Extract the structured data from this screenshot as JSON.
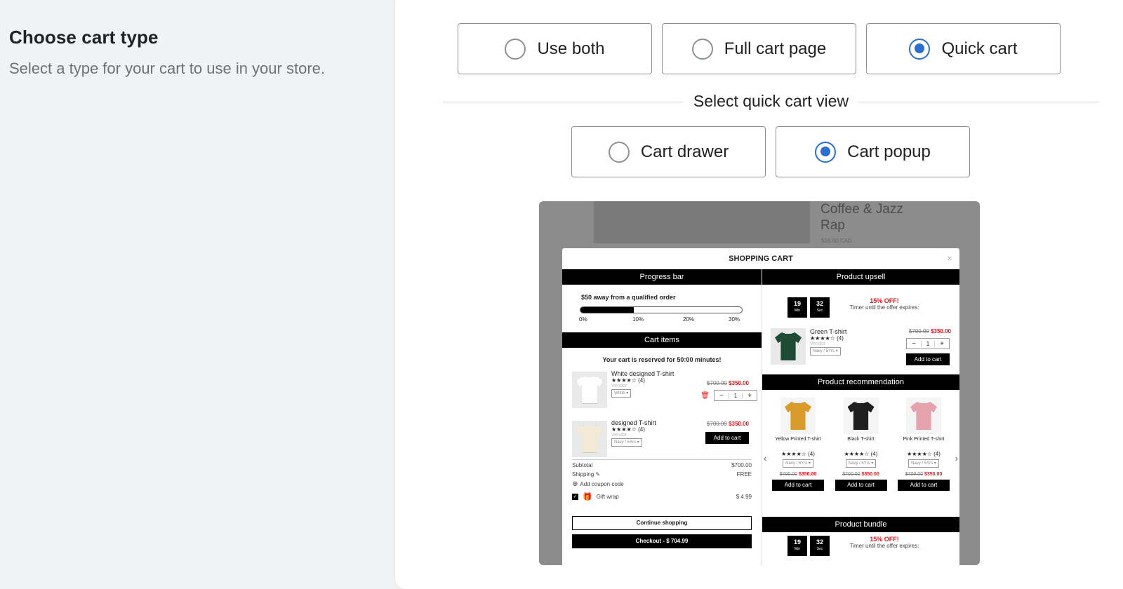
{
  "section": {
    "title": "Choose cart type",
    "description": "Select a type for your cart to use in your store."
  },
  "cart_type_options": [
    {
      "label": "Use both",
      "selected": false
    },
    {
      "label": "Full cart page",
      "selected": false
    },
    {
      "label": "Quick cart",
      "selected": true
    }
  ],
  "quick_view": {
    "heading": "Select quick cart view",
    "options": [
      {
        "label": "Cart drawer",
        "selected": false
      },
      {
        "label": "Cart popup",
        "selected": true
      }
    ]
  },
  "preview": {
    "background_product": {
      "title_line1": "Coffee & Jazz",
      "title_line2": "Rap",
      "price": "$36.00 CAD"
    },
    "modal_title": "SHOPPING CART",
    "close_glyph": "×",
    "progress": {
      "bar_title": "Progress bar",
      "message": "$50 away from a qualified order",
      "fill_fraction": 0.33,
      "ticks": [
        "0%",
        "10%",
        "20%",
        "30%"
      ]
    },
    "cart_items": {
      "bar_title": "Cart items",
      "reserved_text": "Your cart is reserved for 50:00 minutes!",
      "items": [
        {
          "name": "White designed T-shirt",
          "stars": "★★★★☆ (4)",
          "vendor": "Vendor",
          "variant": "White ▾",
          "old_price": "$700.00",
          "price": "$350.00",
          "qty": "1"
        },
        {
          "name": "designed T-shirt",
          "stars": "★★★★☆ (4)",
          "vendor": "Vendor",
          "variant": "Navy / 5Yrs ▾",
          "old_price": "$700.00",
          "price": "$350.00",
          "button": "Add to cart"
        }
      ],
      "subtotal_label": "Subtotal",
      "subtotal_value": "$700.00",
      "shipping_label": "Shipping ✎",
      "shipping_value": "FREE",
      "coupon_label": "Add coupon code",
      "gift_label": "Gift wrap",
      "gift_value": "$ 4.99",
      "continue_label": "Continue shopping",
      "checkout_label": "Checkout - $ 704.99"
    },
    "upsell": {
      "bar_title": "Product upsell",
      "timer": [
        {
          "value": "19",
          "unit": "Min"
        },
        {
          "value": "32",
          "unit": "Sec"
        }
      ],
      "offer": "15% OFF!",
      "offer_sub": "Timer until the offer expires:",
      "product": {
        "name": "Green T-shirt",
        "stars": "★★★★☆ (4)",
        "vendor": "Vendor",
        "variant": "Navy / 5Yrs ▾",
        "old_price": "$700.00",
        "price": "$350.00",
        "qty": "1",
        "button": "Add to cart"
      }
    },
    "recommendation": {
      "bar_title": "Product recommendation",
      "prev": "‹",
      "next": "›",
      "items": [
        {
          "name": "Yellow Printed T-shirt",
          "stars": "★★★★☆ (4)",
          "variant": "Navy / 5Yrs ▾",
          "old_price": "$700.00",
          "price": "$350.00",
          "button": "Add to cart",
          "color": "#d99b2b"
        },
        {
          "name": "Black T-shirt",
          "stars": "★★★★☆ (4)",
          "variant": "Navy / 5Yrs ▾",
          "old_price": "$700.00",
          "price": "$350.00",
          "button": "Add to cart",
          "color": "#1f1f1f"
        },
        {
          "name": "Pink Printed T-shirt",
          "stars": "★★★★☆ (4)",
          "variant": "Navy / 5Yrs ▾",
          "old_price": "$700.00",
          "price": "$350.00",
          "button": "Add to cart",
          "color": "#e5a3ad"
        }
      ]
    },
    "bundle": {
      "bar_title": "Product bundle",
      "timer": [
        {
          "value": "19",
          "unit": "Min"
        },
        {
          "value": "32",
          "unit": "Sec"
        }
      ],
      "offer": "15% OFF!",
      "offer_sub": "Timer until the offer expires:"
    }
  },
  "colors": {
    "accent": "#2c6ecb",
    "sale": "#e4141b"
  }
}
